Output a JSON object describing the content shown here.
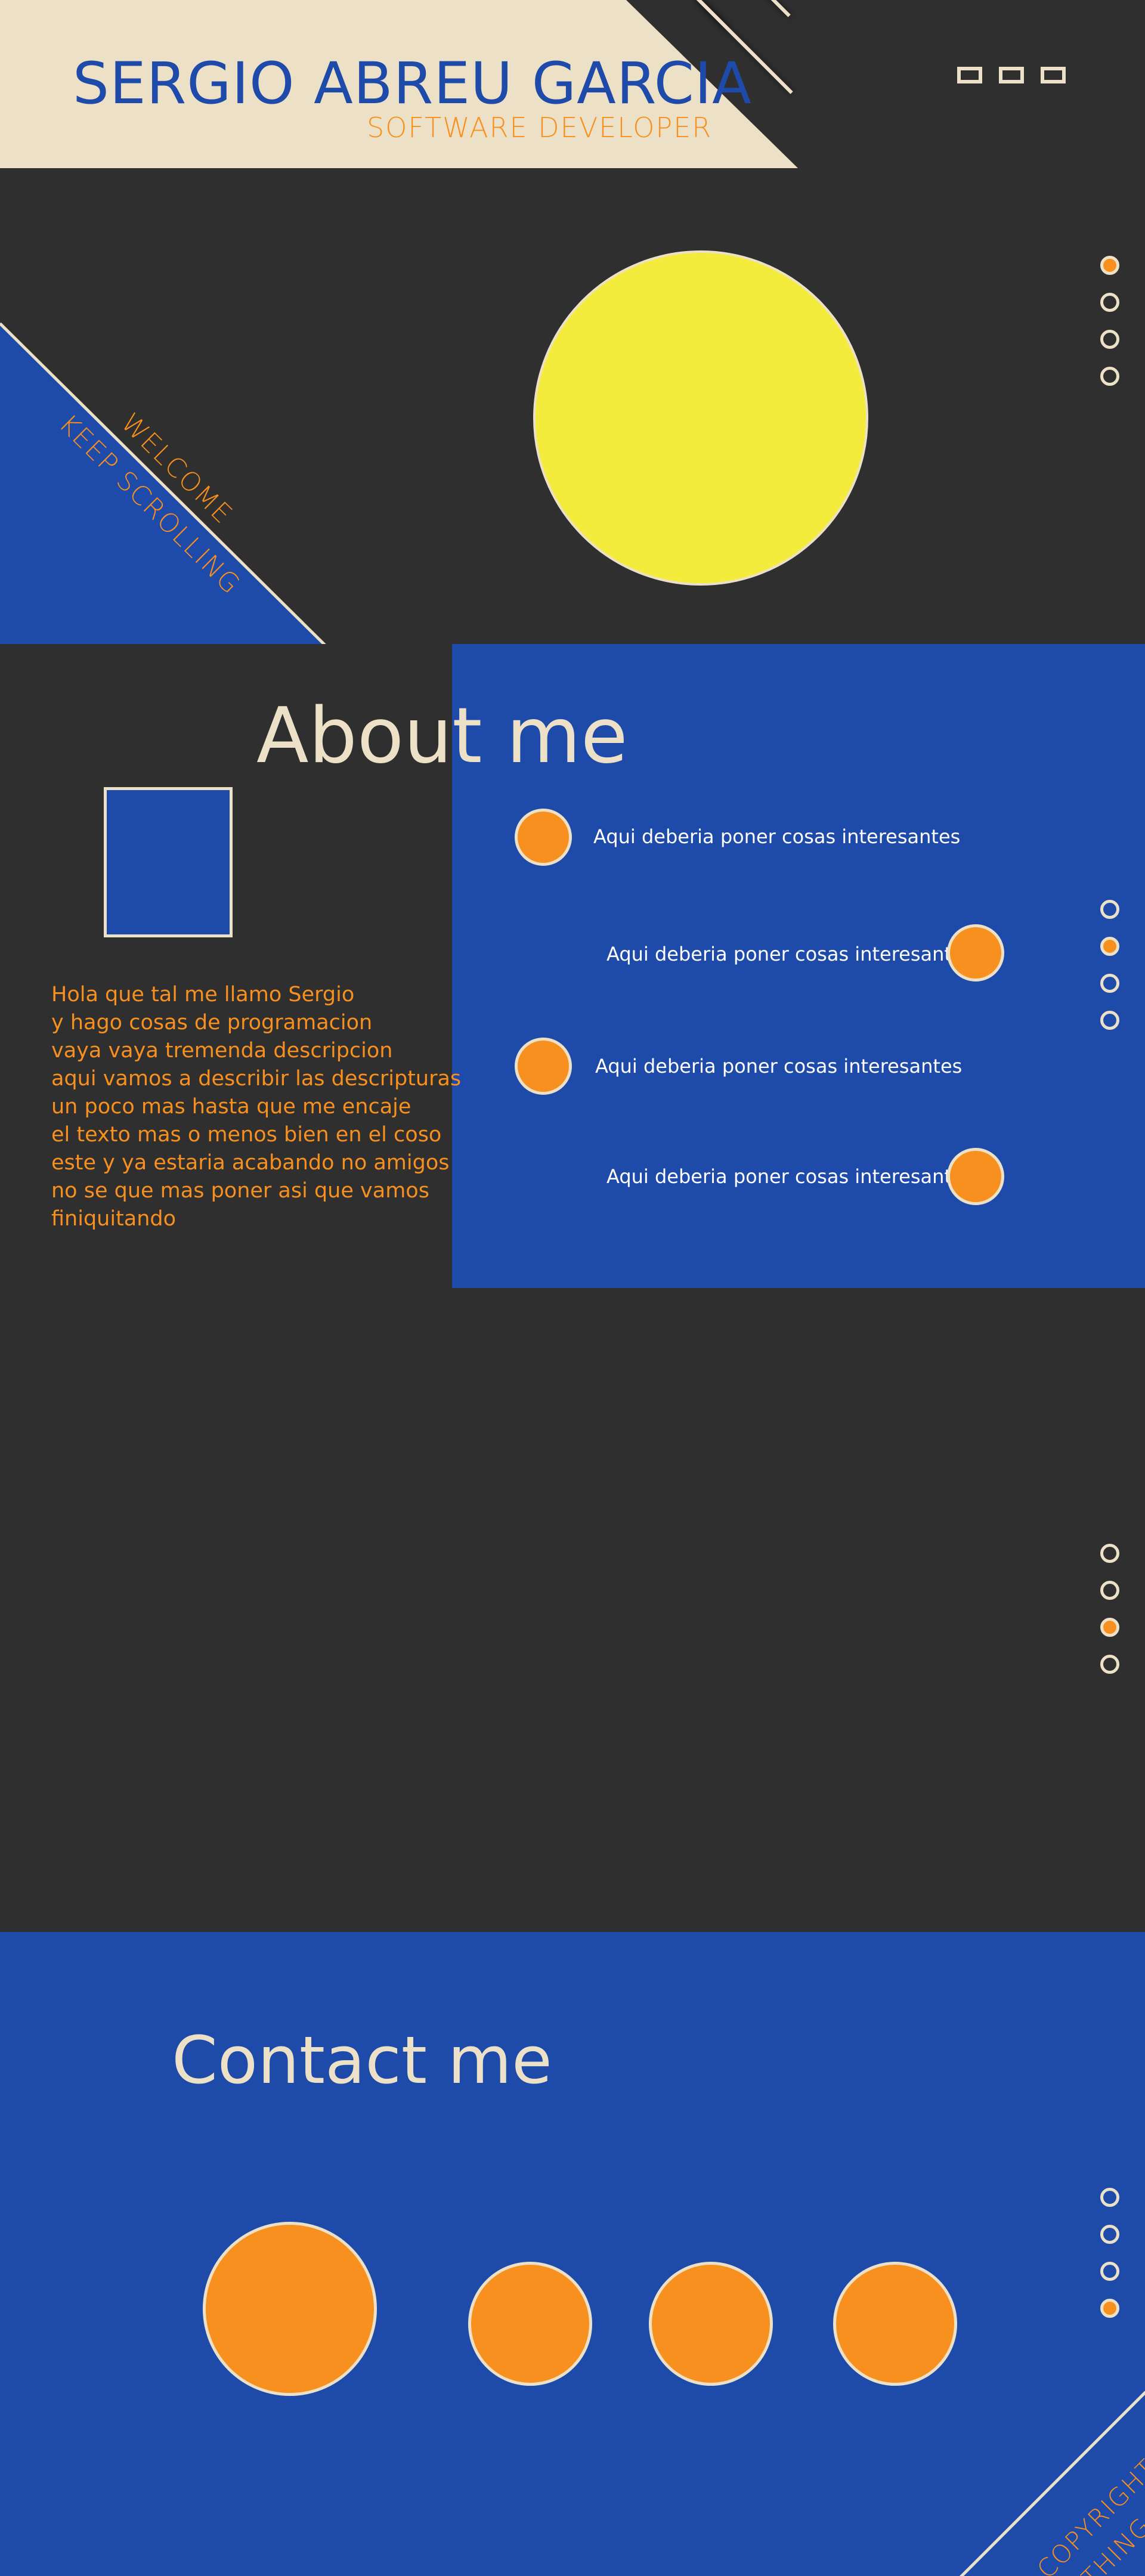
{
  "colors": {
    "background": "#2f2f2f",
    "blue": "#1e4aaa",
    "cream": "#ece1c6",
    "orange": "#f7901e",
    "yellow": "#f4ec3c"
  },
  "header": {
    "name": "SERGIO ABREU GARCIA",
    "role": "SOFTWARE DEVELOPER",
    "nav_icons": [
      "menu-box-icon",
      "menu-box-icon",
      "menu-box-icon"
    ]
  },
  "hero": {
    "welcome": "WELCOME",
    "keep_scrolling": "KEEP SCROLLING"
  },
  "section_nav": {
    "count": 4,
    "hero_active_index": 0,
    "about_active_index": 1,
    "empty_active_index": 2,
    "contact_active_index": 3
  },
  "about": {
    "title": "About me",
    "bio_lines": [
      "Hola que tal me llamo Sergio",
      "y hago cosas de programacion",
      "vaya vaya tremenda descripcion",
      "aqui vamos a describir las descripturas",
      "un poco mas hasta que me encaje",
      "el texto mas o menos bien en el coso",
      "este y ya estaria acabando no amigos",
      "no se que mas poner asi que vamos",
      "finiquitando"
    ],
    "items": [
      "Aqui deberia poner cosas interesantes",
      "Aqui deberia poner cosas interesantes",
      "Aqui deberia poner cosas interesantes",
      "Aqui deberia poner cosas interesantes"
    ]
  },
  "contact": {
    "title": "Contact me"
  },
  "footer": {
    "copyright_line1": "COPYRIGHT",
    "copyright_line2": "THING"
  }
}
